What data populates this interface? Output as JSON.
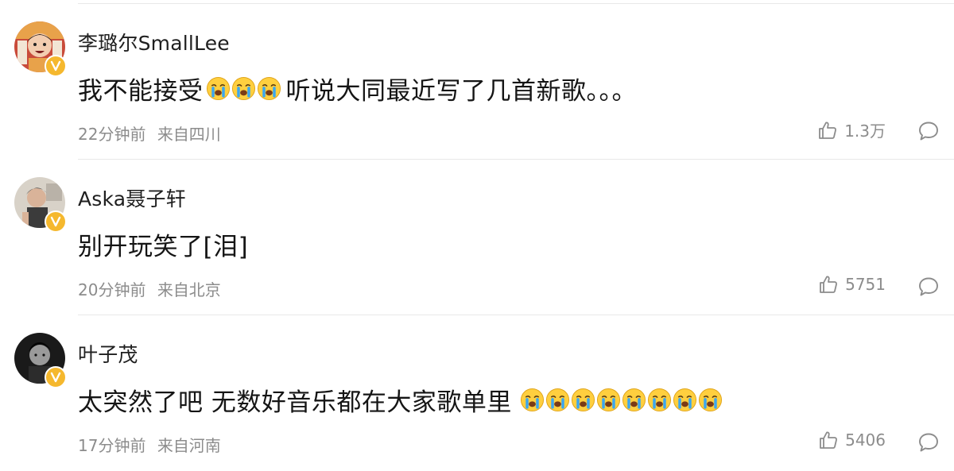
{
  "comments": [
    {
      "username": "李璐尔SmallLee",
      "text_before": "我不能接受",
      "emoji_count_1": 3,
      "text_after": "听说大同最近写了几首新歌。。。",
      "time": "22分钟前",
      "location": "来自四川",
      "likes": "1.3万",
      "avatar_icon": "avatar-photo-icon",
      "verified_icon": "verified-v-icon"
    },
    {
      "username": "Aska聂子轩",
      "text_before": "别开玩笑了[泪]",
      "emoji_count_1": 0,
      "text_after": "",
      "time": "20分钟前",
      "location": "来自北京",
      "likes": "5751",
      "avatar_icon": "avatar-photo-icon",
      "verified_icon": "verified-v-icon"
    },
    {
      "username": "叶子茂",
      "text_before": "太突然了吧 无数好音乐都在大家歌单里",
      "emoji_count_1": 8,
      "text_after": "",
      "time": "17分钟前",
      "location": "来自河南",
      "likes": "5406",
      "avatar_icon": "avatar-photo-icon",
      "verified_icon": "verified-v-icon"
    }
  ],
  "icons": {
    "like": "thumbs-up-icon",
    "reply": "comment-bubble-icon",
    "emoji": "crying-face-icon"
  },
  "colors": {
    "verified_badge": "#f5b82e",
    "meta_text": "#8c8c8c",
    "divider": "#e8e8e8"
  }
}
